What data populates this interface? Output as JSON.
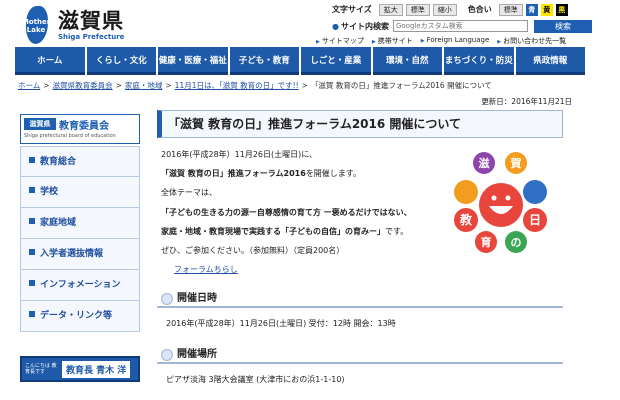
{
  "header": {
    "logo_mark": "Mother Lake",
    "logo_name": "滋賀県",
    "logo_sub": "Shiga Prefecture",
    "text_size_label": "文字サイズ",
    "text_size_options": [
      "拡大",
      "標準",
      "縮小"
    ],
    "color_label": "色合い",
    "color_standard": "標準",
    "color_options": [
      "青",
      "黄",
      "黒"
    ],
    "search_label": "サイト内検索",
    "search_placeholder": "Googleカスタム検索",
    "search_button": "検索",
    "util_links": [
      "サイトマップ",
      "携帯サイト",
      "Foreign Language",
      "お問い合わせ先一覧"
    ]
  },
  "nav": [
    "ホーム",
    "くらし・文化",
    "健康・医療・福祉",
    "子ども・教育",
    "しごと・産業",
    "環境・自然",
    "まちづくり・防災",
    "県政情報"
  ],
  "breadcrumb": [
    "ホーム",
    "滋賀県教育委員会",
    "家庭・地域",
    "11月1日は、「滋賀 教育の日」です!!",
    "「滋賀 教育の日」推進フォーラム2016 開催について"
  ],
  "updated": "更新日：2016年11月21日",
  "sidebar": {
    "icon_text": "滋賀県",
    "title": "教育委員会",
    "title_en": "Shiga prefectural board of education",
    "items": [
      "教育総合",
      "学校",
      "家庭地域",
      "入学者選抜情報",
      "インフォメーション",
      "データ・リンク等"
    ],
    "banner_small": "こんにちは 教育長です",
    "banner_name": "教育長 青木 洋"
  },
  "main": {
    "title": "「滋賀 教育の日」推進フォーラム2016 開催について",
    "lines": [
      "2016年(平成28年）11月26日(土曜日)に、",
      "「滋賀 教育の日」推進フォーラム2016",
      "を開催します。",
      "全体テーマは、",
      "「子どもの生きる力の源ー自尊感情の育て方 ー褒めるだけではない、",
      "家庭・地域・教育現場で実践する「子どもの自信」の育みー」",
      "です。",
      "ぜひ、ご参加ください。（参加無料）（定員200名）",
      "フォーラムちらし"
    ],
    "poster_chars": [
      "滋",
      "賀",
      "教",
      "日",
      "育",
      "の"
    ],
    "sections": [
      {
        "title": "開催日時",
        "text": "2016年(平成28年）11月26日(土曜日)  受付：12時  開会：13時"
      },
      {
        "title": "開催場所",
        "text": "ピアザ淡海 3階大会議室 (大津市におの浜1-1-10)"
      }
    ]
  },
  "colors": {
    "brand": "#1f5fb2",
    "nav": "#1e5aa8",
    "poster_red": "#e8453c",
    "poster_orange": "#f39c20",
    "poster_blue": "#2f6fc6",
    "poster_purple": "#8e44ad",
    "poster_green": "#3aa655"
  }
}
